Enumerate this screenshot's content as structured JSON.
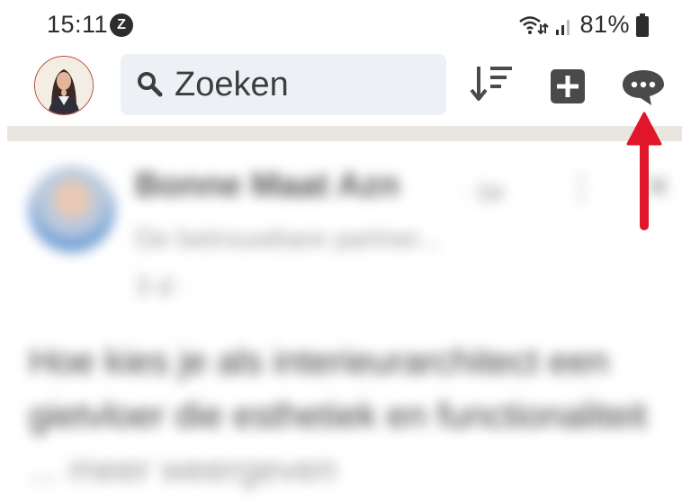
{
  "status_bar": {
    "time": "15:11",
    "app_badge": "Z",
    "battery": "81%",
    "icons": [
      "wifi-calling-icon",
      "signal-icon",
      "battery-icon"
    ]
  },
  "top_bar": {
    "search_placeholder": "Zoeken",
    "icons": [
      "search-icon",
      "sort-icon",
      "add-post-icon",
      "messaging-icon"
    ]
  },
  "feed": {
    "author_name": "Bonne Maat Azn",
    "degree": "· 1e",
    "headline": "De betrouwbare partner...",
    "time": "3 d ·",
    "post_text": "Hoe kies je als interieurarchitect een gietvloer die esthetiek en functionaliteit",
    "see_more": "... meer weergeven"
  },
  "colors": {
    "search_bg": "#edf1f6",
    "icon_dark": "#4a4a4a",
    "separator": "#e9e5df",
    "annotation_arrow": "#e0172b"
  }
}
